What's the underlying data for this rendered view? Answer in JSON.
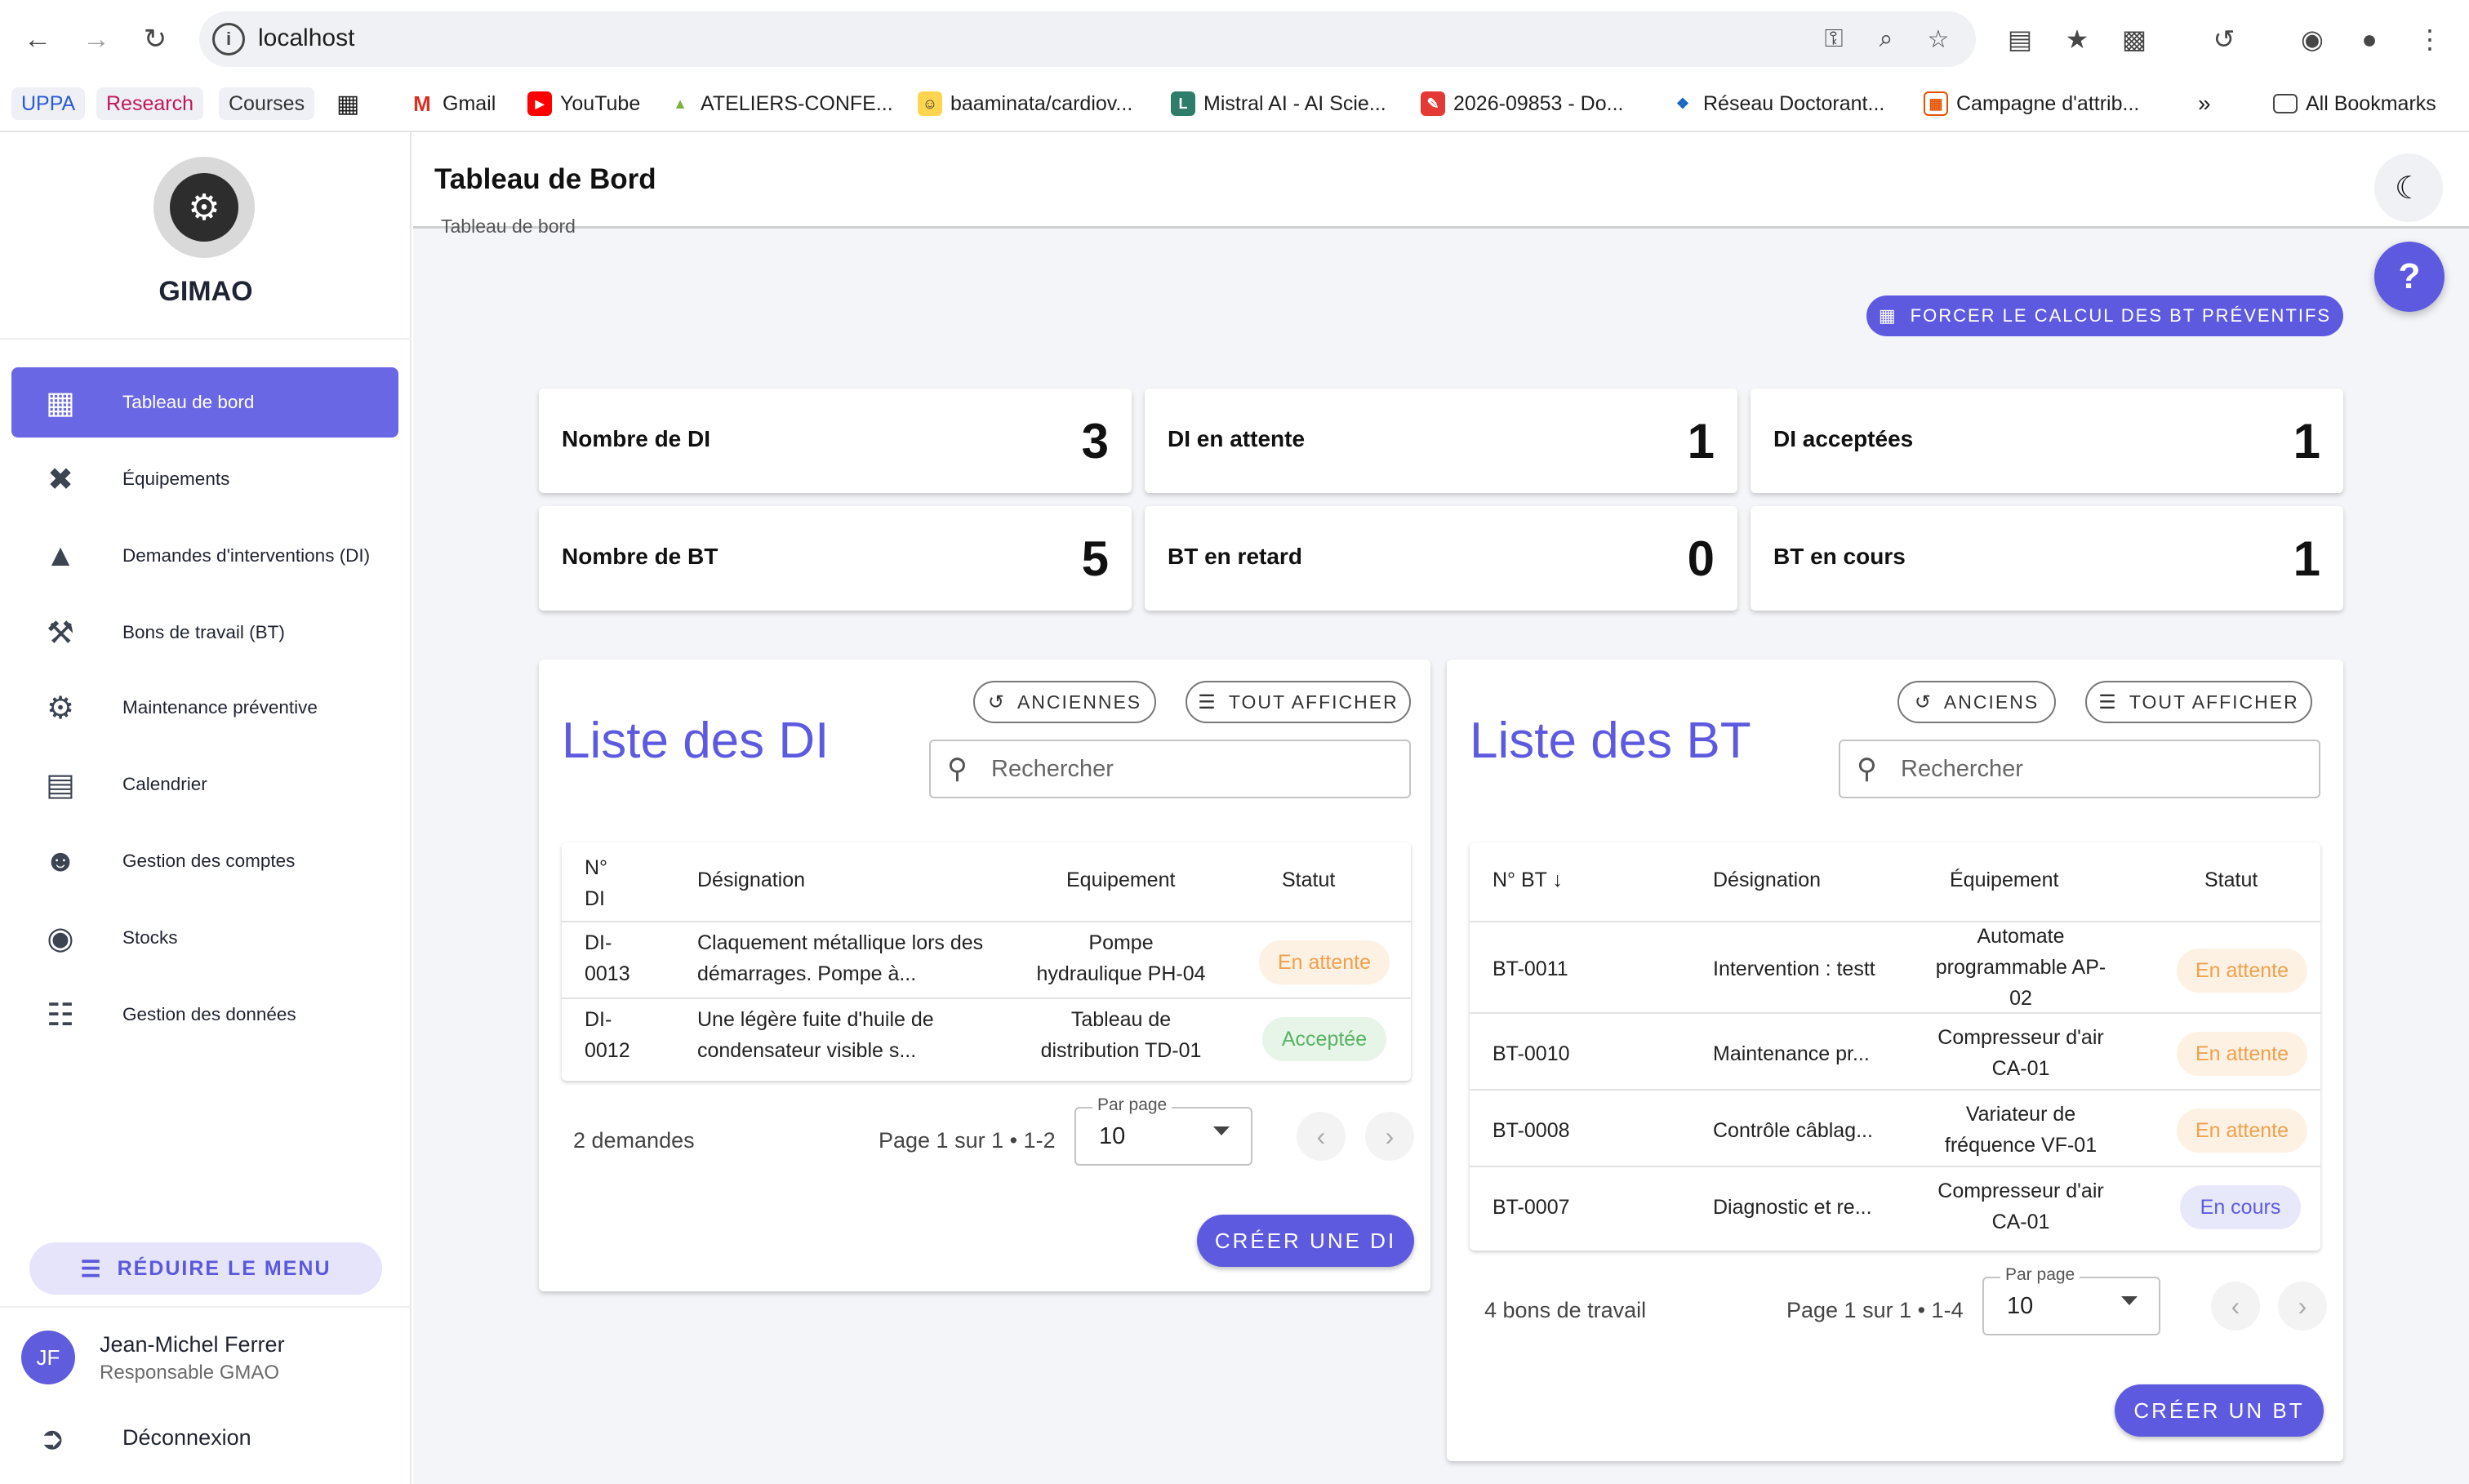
{
  "browser": {
    "url": "localhost",
    "bookmarks": [
      {
        "label": "UPPA"
      },
      {
        "label": "Research"
      },
      {
        "label": "Courses"
      },
      {
        "label": "Gmail"
      },
      {
        "label": "YouTube"
      },
      {
        "label": "ATELIERS-CONFE..."
      },
      {
        "label": "baaminata/cardiov..."
      },
      {
        "label": "Mistral AI - AI Scie..."
      },
      {
        "label": "2026-09853 - Do..."
      },
      {
        "label": "Réseau Doctorant..."
      },
      {
        "label": "Campagne d'attrib..."
      },
      {
        "label": "All Bookmarks"
      }
    ]
  },
  "sidebar": {
    "app_name": "GIMAO",
    "items": [
      {
        "label": "Tableau de bord"
      },
      {
        "label": "Équipements"
      },
      {
        "label": "Demandes d'interventions (DI)"
      },
      {
        "label": "Bons de travail (BT)"
      },
      {
        "label": "Maintenance préventive"
      },
      {
        "label": "Calendrier"
      },
      {
        "label": "Gestion des comptes"
      },
      {
        "label": "Stocks"
      },
      {
        "label": "Gestion des données"
      }
    ],
    "reduce_label": "RÉDUIRE LE MENU",
    "user": {
      "initials": "JF",
      "name": "Jean-Michel Ferrer",
      "role": "Responsable GMAO"
    },
    "logout_label": "Déconnexion"
  },
  "header": {
    "title": "Tableau de Bord"
  },
  "main": {
    "breadcrumb": "Tableau de bord",
    "help_label": "?",
    "force_label": "FORCER LE CALCUL DES BT PRÉVENTIFS",
    "stats": [
      {
        "label": "Nombre de DI",
        "value": "3"
      },
      {
        "label": "DI en attente",
        "value": "1"
      },
      {
        "label": "DI acceptées",
        "value": "1"
      },
      {
        "label": "Nombre de BT",
        "value": "5"
      },
      {
        "label": "BT en retard",
        "value": "0"
      },
      {
        "label": "BT en cours",
        "value": "1"
      }
    ],
    "di": {
      "title": "Liste des DI",
      "old_label": "ANCIENNES",
      "all_label": "TOUT AFFICHER",
      "search_placeholder": "Rechercher",
      "headers": {
        "num1": "N°",
        "num2": "DI",
        "designation": "Désignation",
        "equipment": "Equipement",
        "status": "Statut"
      },
      "rows": [
        {
          "num1": "DI-",
          "num2": "0013",
          "des1": "Claquement métallique lors des",
          "des2": "démarrages. Pompe à...",
          "eq1": "Pompe",
          "eq2": "hydraulique PH-04",
          "status": "En attente"
        },
        {
          "num1": "DI-",
          "num2": "0012",
          "des1": "Une légère fuite d'huile de",
          "des2": "condensateur visible s...",
          "eq1": "Tableau de",
          "eq2": "distribution TD-01",
          "status": "Acceptée"
        }
      ],
      "count": "2 demandes",
      "page_info": "Page 1 sur 1 • 1-2",
      "per_page_label": "Par page",
      "per_page_value": "10",
      "create_label": "CRÉER UNE DI"
    },
    "bt": {
      "title": "Liste des BT",
      "old_label": "ANCIENS",
      "all_label": "TOUT AFFICHER",
      "search_placeholder": "Rechercher",
      "headers": {
        "num": "N° BT",
        "designation": "Désignation",
        "equipment": "Équipement",
        "status": "Statut"
      },
      "rows": [
        {
          "num": "BT-0011",
          "des": "Intervention : testt",
          "eq1": "Automate",
          "eq2": "programmable AP-",
          "eq3": "02",
          "status": "En attente"
        },
        {
          "num": "BT-0010",
          "des": "Maintenance pr...",
          "eq1": "Compresseur d'air",
          "eq2": "CA-01",
          "status": "En attente"
        },
        {
          "num": "BT-0008",
          "des": "Contrôle câblag...",
          "eq1": "Variateur de",
          "eq2": "fréquence VF-01",
          "status": "En attente"
        },
        {
          "num": "BT-0007",
          "des": "Diagnostic et re...",
          "eq1": "Compresseur d'air",
          "eq2": "CA-01",
          "status": "En cours"
        }
      ],
      "count": "4 bons de travail",
      "page_info": "Page 1 sur 1 • 1-4",
      "per_page_label": "Par page",
      "per_page_value": "10",
      "create_label": "CRÉER UN BT"
    }
  }
}
